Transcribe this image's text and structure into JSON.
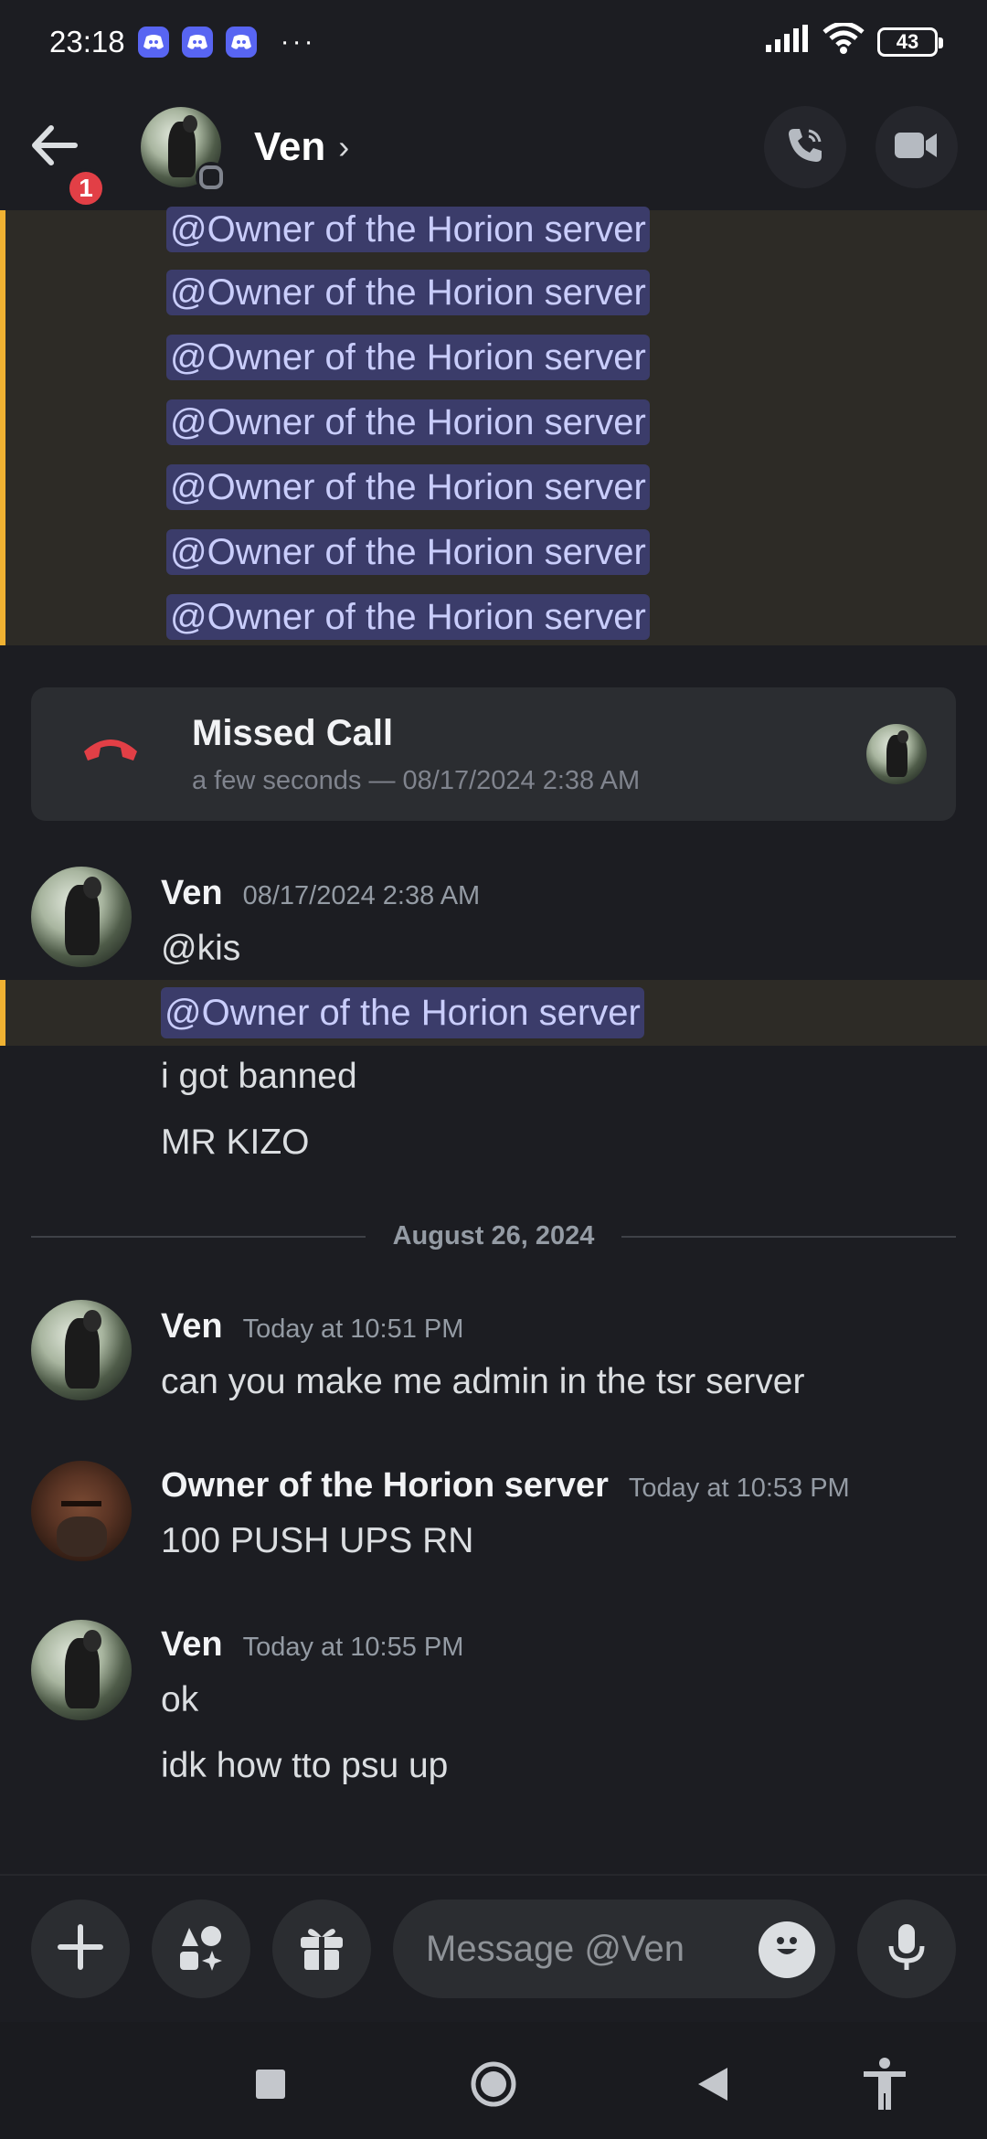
{
  "status_bar": {
    "time": "23:18",
    "more": "···",
    "battery": "43"
  },
  "header": {
    "title": "Ven",
    "unread_count": "1"
  },
  "mention_text": "@Owner of the Horion server",
  "missed_call": {
    "title": "Missed Call",
    "subtitle": "a few seconds — 08/17/2024 2:38 AM"
  },
  "messages": [
    {
      "author": "Ven",
      "timestamp": "08/17/2024 2:38 AM",
      "lines": [
        "@kis",
        "@Owner of the Horion server",
        "i got banned",
        "MR KIZO"
      ]
    },
    {
      "author": "Ven",
      "timestamp": "Today at 10:51 PM",
      "lines": [
        "can you make me admin in the tsr server"
      ]
    },
    {
      "author": "Owner of the Horion server",
      "timestamp": "Today at 10:53 PM",
      "lines": [
        "100 PUSH UPS RN"
      ]
    },
    {
      "author": "Ven",
      "timestamp": "Today at 10:55 PM",
      "lines": [
        "ok",
        "idk how tto psu up"
      ]
    }
  ],
  "date_divider": "August 26, 2024",
  "composer": {
    "placeholder": "Message @Ven"
  },
  "colors": {
    "background": "#1c1d22",
    "mention_highlight": "#2d2b26",
    "mention_bar": "#f0b232",
    "mention_pill": "#3b3c6a",
    "missed_call_red": "#e23f46"
  },
  "icons": [
    "discord-icon",
    "back-arrow-icon",
    "chevron-right-icon",
    "phone-call-icon",
    "video-camera-icon",
    "hangup-phone-icon",
    "plus-icon",
    "apps-icon",
    "gift-icon",
    "emoji-icon",
    "microphone-icon",
    "recents-icon",
    "home-icon",
    "back-icon",
    "accessibility-icon"
  ]
}
